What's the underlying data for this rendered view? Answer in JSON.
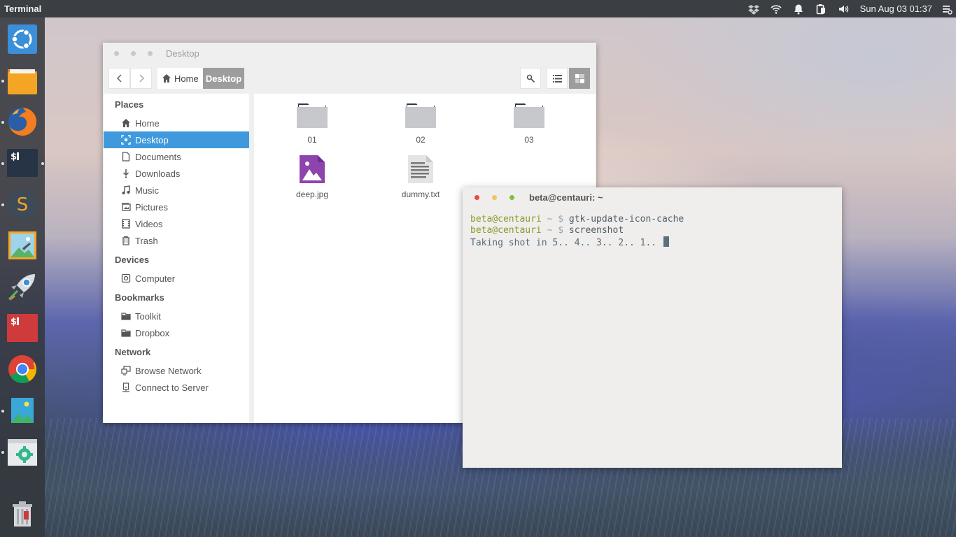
{
  "top_panel": {
    "app_title": "Terminal",
    "clock": "Sun Aug 03  01:37",
    "tray_icons": [
      "dropbox-icon",
      "wifi-icon",
      "bell-icon",
      "clipboard-icon",
      "volume-icon",
      "menu-icon"
    ]
  },
  "launcher": {
    "items": [
      {
        "name": "ubuntu-logo",
        "running": false
      },
      {
        "name": "files",
        "running": true
      },
      {
        "name": "firefox",
        "running": true
      },
      {
        "name": "terminal-dark",
        "running": true
      },
      {
        "name": "sublime-text",
        "running": true
      },
      {
        "name": "image-viewer",
        "running": false
      },
      {
        "name": "rocket",
        "running": false
      },
      {
        "name": "terminal-red",
        "running": false
      },
      {
        "name": "chrome",
        "running": false
      },
      {
        "name": "photos",
        "running": true
      },
      {
        "name": "system-settings",
        "running": true
      },
      {
        "name": "trash",
        "running": false
      }
    ],
    "colors": {
      "files": "#f39c12",
      "terminal": "#2c3e50",
      "terminal_red": "#cf3b3b",
      "sublime": "#3a4a5a"
    }
  },
  "file_manager": {
    "title": "Desktop",
    "breadcrumb": {
      "home": "Home",
      "current": "Desktop"
    },
    "sidebar": {
      "places_heading": "Places",
      "places": [
        {
          "label": "Home",
          "icon": "home-icon"
        },
        {
          "label": "Desktop",
          "icon": "desktop-icon",
          "active": true
        },
        {
          "label": "Documents",
          "icon": "document-icon"
        },
        {
          "label": "Downloads",
          "icon": "download-icon"
        },
        {
          "label": "Music",
          "icon": "music-icon"
        },
        {
          "label": "Pictures",
          "icon": "pictures-icon"
        },
        {
          "label": "Videos",
          "icon": "video-icon"
        },
        {
          "label": "Trash",
          "icon": "trash-icon"
        }
      ],
      "devices_heading": "Devices",
      "devices": [
        {
          "label": "Computer",
          "icon": "drive-icon"
        }
      ],
      "bookmarks_heading": "Bookmarks",
      "bookmarks": [
        {
          "label": "Toolkit",
          "icon": "folder-icon"
        },
        {
          "label": "Dropbox",
          "icon": "folder-icon"
        }
      ],
      "network_heading": "Network",
      "network": [
        {
          "label": "Browse Network",
          "icon": "network-icon"
        },
        {
          "label": "Connect to Server",
          "icon": "server-icon"
        }
      ]
    },
    "files": [
      {
        "name": "01",
        "type": "folder"
      },
      {
        "name": "02",
        "type": "folder"
      },
      {
        "name": "03",
        "type": "folder"
      },
      {
        "name": "deep.jpg",
        "type": "image"
      },
      {
        "name": "dummy.txt",
        "type": "text"
      }
    ],
    "accent": "#3f99dc"
  },
  "terminal": {
    "title": "beta@centauri: ~",
    "lines": [
      {
        "user": "beta@centauri",
        "path": " ~ $ ",
        "cmd": "gtk-update-icon-cache"
      },
      {
        "user": "beta@centauri",
        "path": " ~ $ ",
        "cmd": "screenshot"
      }
    ],
    "output": "Taking shot in 5.. 4.. 3.. 2.. 1.. ",
    "dot_colors": [
      "#e74c3c",
      "#f5c163",
      "#7cc23c"
    ]
  }
}
